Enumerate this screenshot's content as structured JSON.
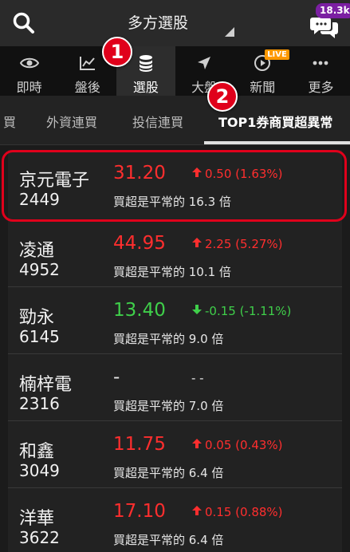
{
  "header": {
    "title": "多方選股",
    "notification_count": "18.3k",
    "icons": {
      "search": "search-icon",
      "chat": "chat-bubbles-icon"
    }
  },
  "nav": {
    "items": [
      {
        "label": "即時",
        "icon": "eye-icon"
      },
      {
        "label": "盤後",
        "icon": "line-chart-icon"
      },
      {
        "label": "選股",
        "icon": "coins-stack-icon",
        "active": true
      },
      {
        "label": "大盤",
        "icon": "navigation-arrow-icon"
      },
      {
        "label": "新聞",
        "icon": "play-circle-icon",
        "tag": "LIVE"
      },
      {
        "label": "更多",
        "icon": "more-dots-icon"
      }
    ]
  },
  "subtabs": {
    "items": [
      "買",
      "外資連買",
      "投信連買",
      "TOP1券商買超異常"
    ],
    "active_index": 3
  },
  "annotations": {
    "marker1": "1",
    "marker2": "2"
  },
  "stocks": [
    {
      "name": "京元電子",
      "code": "2449",
      "price": "31.20",
      "change": "0.50 (1.63%)",
      "direction": "up",
      "note": "買超是平常的 16.3 倍"
    },
    {
      "name": "凌通",
      "code": "4952",
      "price": "44.95",
      "change": "2.25 (5.27%)",
      "direction": "up",
      "note": "買超是平常的 10.1 倍"
    },
    {
      "name": "勁永",
      "code": "6145",
      "price": "13.40",
      "change": "-0.15 (-1.11%)",
      "direction": "down",
      "note": "買超是平常的 9.0 倍"
    },
    {
      "name": "楠梓電",
      "code": "2316",
      "price": "-",
      "change": "- -",
      "direction": "flat",
      "note": "買超是平常的 7.0 倍"
    },
    {
      "name": "和鑫",
      "code": "3049",
      "price": "11.75",
      "change": "0.05 (0.43%)",
      "direction": "up",
      "note": "買超是平常的 6.4 倍"
    },
    {
      "name": "洋華",
      "code": "3622",
      "price": "17.10",
      "change": "0.15 (0.88%)",
      "direction": "up",
      "note": "買超是平常的 6.4 倍"
    }
  ],
  "colors": {
    "up": "#ff2e2e",
    "down": "#3fcf4a",
    "highlight": "#e0001b",
    "badge": "#7b1fa2",
    "live": "#ff9800"
  }
}
